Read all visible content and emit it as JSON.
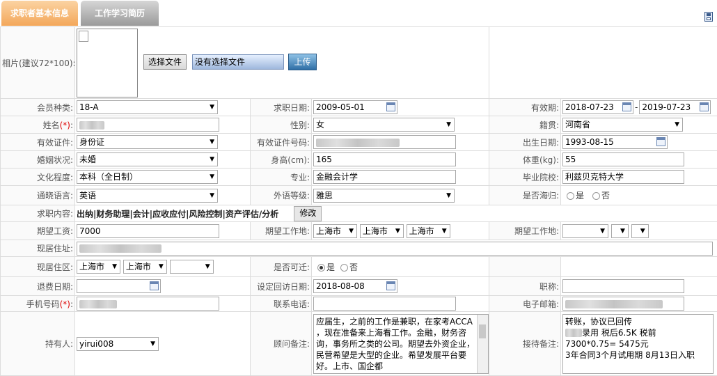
{
  "tabs": {
    "basic": "求职者基本信息",
    "history": "工作学习简历"
  },
  "photo": {
    "label": "相片(建议72*100):",
    "choose_file": "选择文件",
    "no_file": "没有选择文件",
    "upload": "上传"
  },
  "member_type": {
    "label": "会员种类:",
    "value": "18-A"
  },
  "job_date": {
    "label": "求职日期:",
    "value": "2009-05-01"
  },
  "valid_period": {
    "label": "有效期:",
    "start": "2018-07-23",
    "sep": "-",
    "end": "2019-07-23"
  },
  "name": {
    "label": "姓名",
    "req": "(*)",
    "colon": ":"
  },
  "gender": {
    "label": "性别:",
    "value": "女"
  },
  "native_place": {
    "label": "籍贯:",
    "value": "河南省"
  },
  "id_type": {
    "label": "有效证件:",
    "value": "身份证"
  },
  "id_number": {
    "label": "有效证件号码:"
  },
  "birth_date": {
    "label": "出生日期:",
    "value": "1993-08-15"
  },
  "marital": {
    "label": "婚姻状况:",
    "value": "未婚"
  },
  "height": {
    "label": "身高(cm):",
    "value": "165"
  },
  "weight": {
    "label": "体重(kg):",
    "value": "55"
  },
  "education": {
    "label": "文化程度:",
    "value": "本科（全日制）"
  },
  "major": {
    "label": "专业:",
    "value": "金融会计学"
  },
  "school": {
    "label": "毕业院校:",
    "value": "利兹贝克特大学"
  },
  "language": {
    "label": "通晓语言:",
    "value": "英语"
  },
  "foreign_level": {
    "label": "外语等级:",
    "value": "雅思"
  },
  "overseas": {
    "label": "是否海归:",
    "yes": "是",
    "no": "否"
  },
  "job_content": {
    "label": "求职内容:",
    "value": "出纳|财务助理|会计|应收应付|风险控制|资产评估/分析",
    "edit": "修改"
  },
  "salary": {
    "label": "期望工资:",
    "value": "7000"
  },
  "expect_place": {
    "label": "期望工作地:",
    "v1": "上海市",
    "v2": "上海市",
    "v3": "上海市"
  },
  "expect_place2": {
    "label": "期望工作地:"
  },
  "address": {
    "label": "现居住址:"
  },
  "district": {
    "label": "现居住区:",
    "v1": "上海市",
    "v2": "上海市"
  },
  "relocate": {
    "label": "是否可迁:",
    "yes": "是",
    "no": "否"
  },
  "refund_date": {
    "label": "退费日期:"
  },
  "revisit_date": {
    "label": "设定回访日期:",
    "value": "2018-08-08"
  },
  "title": {
    "label": "职称:"
  },
  "mobile": {
    "label": "手机号码",
    "req": "(*)",
    "colon": ":"
  },
  "phone": {
    "label": "联系电话:"
  },
  "email": {
    "label": "电子邮箱:"
  },
  "holder": {
    "label": "持有人:",
    "value": "yirui008"
  },
  "advisor_note": {
    "label": "顾问备注:",
    "text": "应届生，之前的工作是兼职，在家考ACCA ，现在准备来上海看工作。金融，财务咨询，事务所之类的公司。期望去外资企业，民营希望是大型的企业。希望发展平台要好。上市、国企都"
  },
  "reception_note": {
    "label": "接待备注:",
    "line1": "转账，协议已回传",
    "line2": "录用 税后6.5K  税前",
    "line3": "7300*0.75= 5475元",
    "line4": "3年合同3个月试用期 8月13日入职"
  }
}
